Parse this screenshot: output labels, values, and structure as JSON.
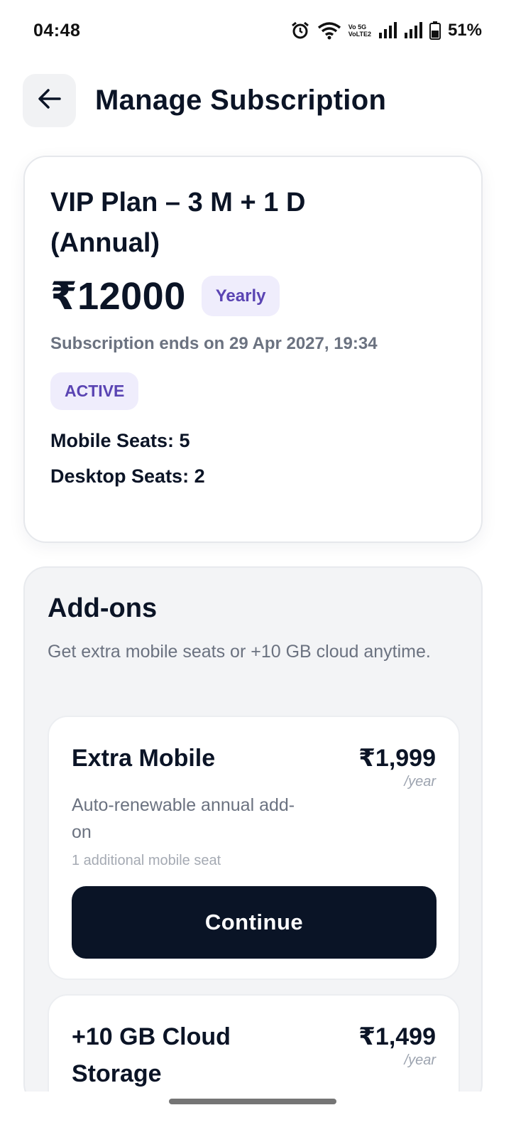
{
  "status_bar": {
    "time": "04:48",
    "network_label_top": "Vo 5G",
    "network_label_bottom": "VoLTE2",
    "battery": "51%"
  },
  "header": {
    "back_icon": "arrow-left-icon",
    "title": "Manage Subscription"
  },
  "plan": {
    "name": "VIP Plan – 3 M + 1 D (Annual)",
    "price": "₹12000",
    "cycle": "Yearly",
    "ends": "Subscription ends on 29 Apr 2027, 19:34",
    "status": "ACTIVE",
    "mobile_seats": "Mobile Seats: 5",
    "desktop_seats": "Desktop Seats: 2"
  },
  "addons": {
    "title": "Add-ons",
    "subtitle": "Get extra mobile seats or +10 GB cloud anytime.",
    "items": [
      {
        "name": "Extra Mobile",
        "price": "₹1,999",
        "period": "/year",
        "description": "Auto-renewable annual add-on",
        "note": "1 additional mobile seat",
        "button": "Continue"
      },
      {
        "name": "+10 GB Cloud Storage",
        "price": "₹1,499",
        "period": "/year"
      }
    ]
  },
  "colors": {
    "primary_dark": "#0a1426",
    "badge_bg": "#efedfc",
    "badge_text": "#5a44b3",
    "muted_text": "#6b7280"
  }
}
